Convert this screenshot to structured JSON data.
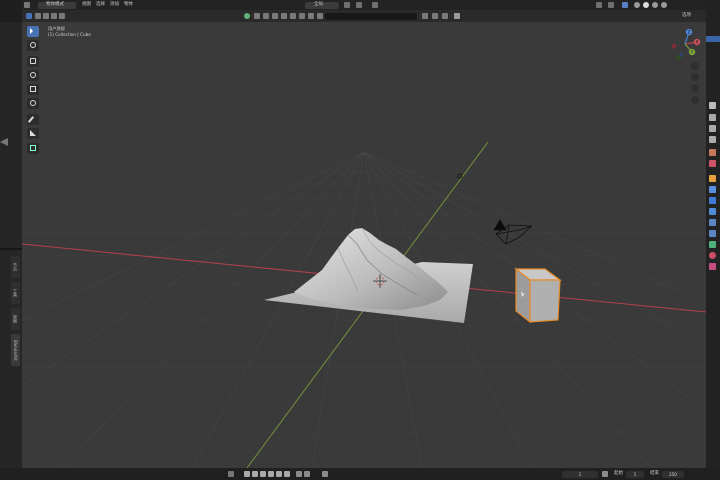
{
  "header": {
    "mode": "物体模式",
    "menus": [
      "视图",
      "选择",
      "添加",
      "物体"
    ],
    "transform_orientation": "全局",
    "search_placeholder": "",
    "right_label": "选项"
  },
  "viewport": {
    "view_name": "用户透视",
    "collection_info": "(1) Collection | Cube"
  },
  "left_sidebar": {
    "tabs": [
      "节点",
      "工具",
      "视图",
      "BlenderKit"
    ]
  },
  "timeline": {
    "current_frame": "1",
    "start_label": "起始",
    "start_value": "1",
    "end_label": "结束",
    "end_value": "250"
  },
  "gizmo": {
    "x_label": "X",
    "y_label": "Y",
    "z_label": "Z"
  },
  "colors": {
    "viewport_bg": "#3a3a3a",
    "x_axis": "#b2424b",
    "y_axis": "#7a9a3c",
    "selection": "#e58b2a",
    "active_tool": "#4772b3"
  }
}
